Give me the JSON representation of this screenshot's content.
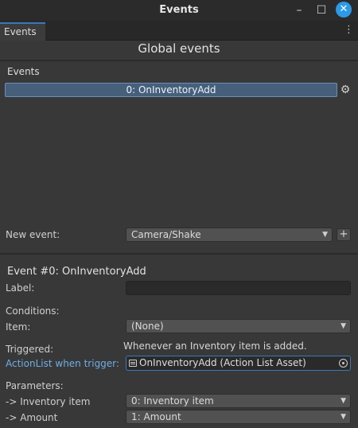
{
  "window": {
    "title": "Events",
    "minimize_glyph": "–",
    "maximize_glyph": "☐",
    "close_glyph": "✕"
  },
  "tabs": [
    {
      "label": "Events",
      "active": true
    }
  ],
  "tab_menu_glyph": "⋮",
  "header": {
    "title": "Global events"
  },
  "events_section": {
    "label": "Events",
    "items": [
      "0: OnInventoryAdd"
    ],
    "settings_icon": "gear-icon"
  },
  "new_event": {
    "label": "New event:",
    "selected": "Camera/Shake",
    "add_label": "+"
  },
  "event_detail": {
    "heading": "Event #0: OnInventoryAdd",
    "label_field": {
      "label": "Label:",
      "value": ""
    },
    "conditions_label": "Conditions:",
    "item": {
      "label": "Item:",
      "selected": "(None)"
    },
    "triggered": {
      "label": "Triggered:",
      "text": "Whenever an Inventory item is added."
    },
    "actionlist": {
      "label": "ActionList when trigger:",
      "value": "OnInventoryAdd (Action List Asset)"
    },
    "parameters_label": "Parameters:",
    "parameters": [
      {
        "label": "-> Inventory item",
        "selected": "0: Inventory item"
      },
      {
        "label": "-> Amount",
        "selected": "1: Amount"
      }
    ]
  },
  "colors": {
    "accent": "#3a79bb",
    "selection": "#46607c",
    "link": "#6faee8",
    "close_button": "#2c9ae8"
  }
}
